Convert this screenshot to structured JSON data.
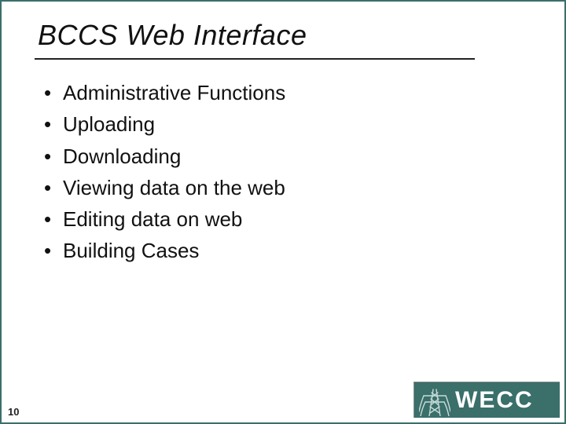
{
  "title": "BCCS Web Interface",
  "bullets": [
    "Administrative Functions",
    "Uploading",
    "Downloading",
    "Viewing data on the web",
    "Editing data on web",
    "Building Cases"
  ],
  "page_number": "10",
  "logo": {
    "text": "WECC"
  }
}
